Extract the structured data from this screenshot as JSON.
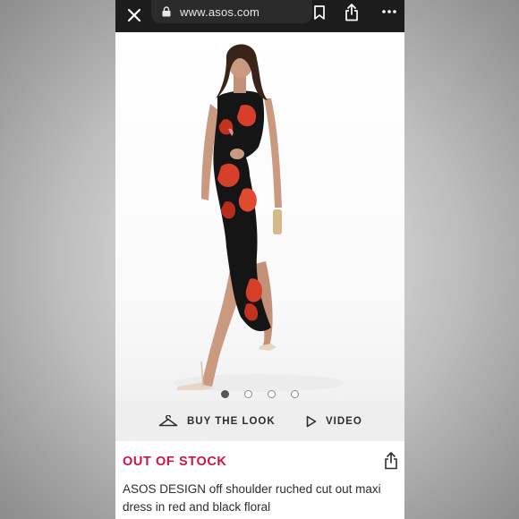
{
  "browser": {
    "url": "www.asos.com",
    "icons": [
      "close-icon",
      "lock-icon",
      "bookmark-icon",
      "share-icon",
      "more-icon"
    ]
  },
  "carousel": {
    "total": 4,
    "active": 1
  },
  "actions": {
    "buy_the_look": "BUY THE LOOK",
    "video": "VIDEO"
  },
  "product": {
    "stock_status": "OUT OF STOCK",
    "title": "ASOS DESIGN off shoulder ruched cut out maxi dress in red and black floral"
  },
  "colors": {
    "status_red": "#d01345",
    "topbar": "#1c1c1c",
    "action_bar": "#eeeeee"
  }
}
